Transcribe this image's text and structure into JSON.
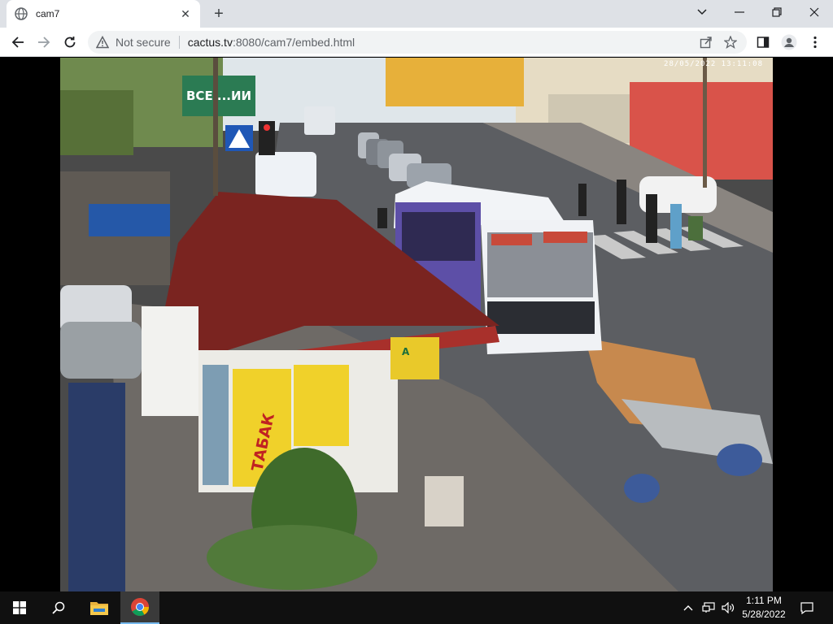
{
  "browser": {
    "tab": {
      "title": "cam7",
      "icon": "globe-icon"
    },
    "new_tab_label": "+",
    "window_controls": {
      "minimize": "chevron-down-icon",
      "min": "–",
      "restore": "❐",
      "close": "✕",
      "dropdown": "⌄"
    },
    "nav": {
      "back": "←",
      "forward": "→",
      "reload": "↻"
    },
    "address": {
      "security_label": "Not secure",
      "host": "cactus.tv",
      "path": ":8080/cam7/embed.html"
    },
    "toolbar_icons": [
      "share-icon",
      "star-icon",
      "sidebar-icon",
      "profile-icon",
      "menu-icon"
    ]
  },
  "camera": {
    "stream_name": "cam7",
    "overlay_timestamp": "28/05/2022 13:11:08",
    "scene_signs": {
      "shop_sign": "ТАБАК",
      "billboard": "ВСЕ ...ИИ",
      "route_label": "A"
    }
  },
  "taskbar": {
    "apps": [
      "start-icon",
      "search-icon",
      "file-explorer-icon",
      "chrome-icon"
    ],
    "tray": [
      "chevron-up-icon",
      "network-icon",
      "volume-icon"
    ],
    "clock": {
      "time": "1:11 PM",
      "date": "5/28/2022"
    },
    "notification": "notification-icon"
  }
}
